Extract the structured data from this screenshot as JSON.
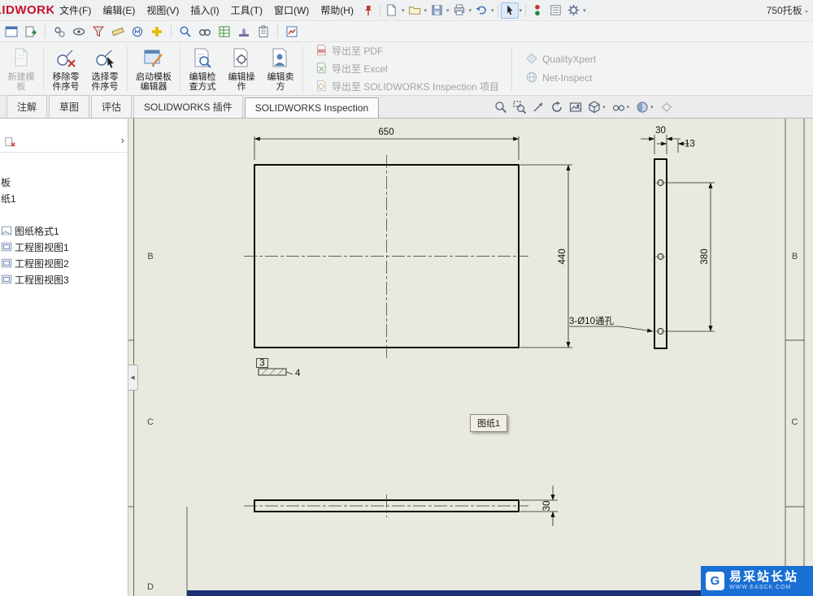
{
  "titlebar": {
    "logo": "SOLIDWORKS",
    "menus": [
      "文件(F)",
      "编辑(E)",
      "视图(V)",
      "插入(I)",
      "工具(T)",
      "窗口(W)",
      "帮助(H)"
    ],
    "document_title": "750托板 -"
  },
  "ribbon": {
    "buttons": [
      {
        "label": "新建模\n板",
        "enabled": false
      },
      {
        "label": "移除零\n件序号",
        "enabled": true
      },
      {
        "label": "选择零\n件序号",
        "enabled": true
      },
      {
        "label": "启动模板\n编辑器",
        "enabled": true
      },
      {
        "label": "编辑检\n查方式",
        "enabled": true
      },
      {
        "label": "编辑操\n作",
        "enabled": true
      },
      {
        "label": "编辑卖\n方",
        "enabled": true
      }
    ],
    "export_items": [
      "导出至 PDF",
      "导出至 Excel",
      "导出至 SOLIDWORKS Inspection 项目"
    ],
    "services": [
      "QualityXpert",
      "Net-Inspect"
    ]
  },
  "tabs": {
    "items": [
      "注解",
      "草图",
      "评估",
      "SOLIDWORKS 插件",
      "SOLIDWORKS Inspection"
    ],
    "active": "SOLIDWORKS Inspection"
  },
  "tree": {
    "items": [
      "板",
      "纸1",
      "图纸格式1",
      "工程图视图1",
      "工程图视图2",
      "工程图视图3"
    ]
  },
  "drawing": {
    "tooltip": "图纸1",
    "zones_left": [
      "B",
      "C",
      "D"
    ],
    "zones_right": [
      "B",
      "C"
    ],
    "dims": {
      "front_width": "650",
      "front_height": "440",
      "side_width": "30",
      "side_offset": "13",
      "side_hole_span": "380",
      "hole_note": "3-Ø10通孔",
      "detail_box": "3",
      "detail_len": "4",
      "bottom_thickness": "30"
    }
  },
  "watermark": {
    "title": "易采站长站",
    "subtitle": "WWW.EASCK.COM"
  }
}
